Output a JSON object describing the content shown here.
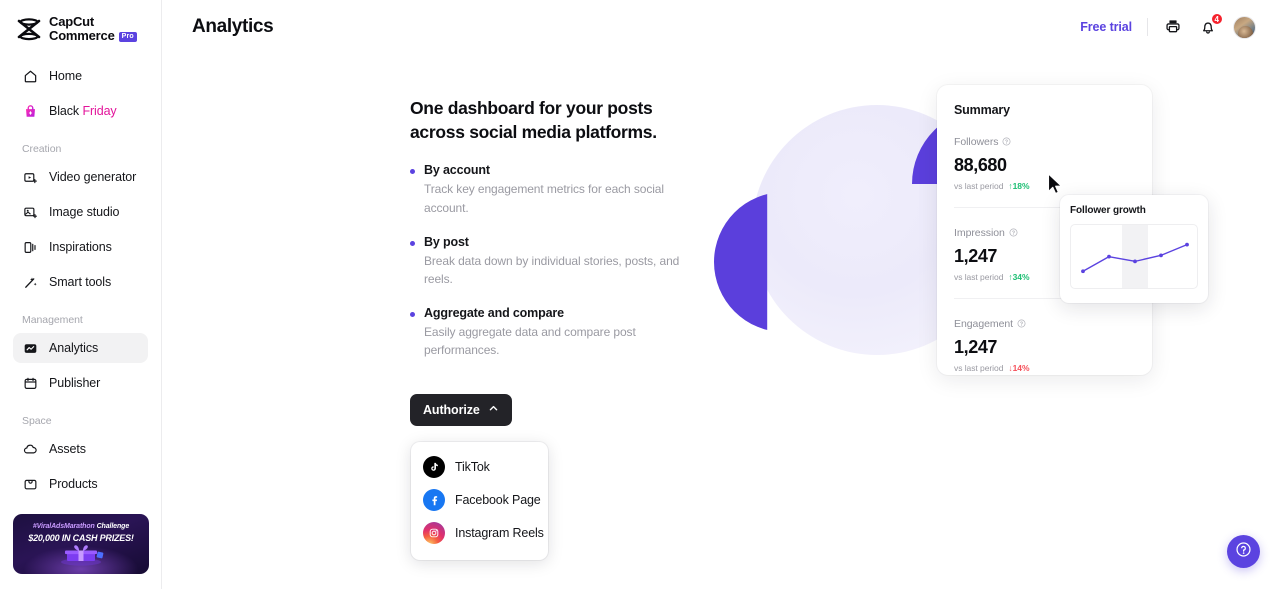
{
  "brand": {
    "line1": "CapCut",
    "line2": "Commerce",
    "badge": "Pro",
    "logo_icon": "capcut-logo-icon"
  },
  "sidebar": {
    "top_items": [
      {
        "label": "Home",
        "icon": "home-icon",
        "active": false
      },
      {
        "label": "Black",
        "label2": "Friday",
        "icon": "bag-icon",
        "active": false
      }
    ],
    "sections": [
      {
        "title": "Creation",
        "items": [
          {
            "label": "Video generator",
            "icon": "video-generator-icon",
            "active": false
          },
          {
            "label": "Image studio",
            "icon": "image-studio-icon",
            "active": false
          },
          {
            "label": "Inspirations",
            "icon": "inspirations-icon",
            "active": false
          },
          {
            "label": "Smart tools",
            "icon": "smart-tools-icon",
            "active": false
          }
        ]
      },
      {
        "title": "Management",
        "items": [
          {
            "label": "Analytics",
            "icon": "analytics-icon",
            "active": true
          },
          {
            "label": "Publisher",
            "icon": "publisher-icon",
            "active": false
          }
        ]
      },
      {
        "title": "Space",
        "items": [
          {
            "label": "Assets",
            "icon": "assets-icon",
            "active": false
          },
          {
            "label": "Products",
            "icon": "products-icon",
            "active": false
          }
        ]
      }
    ],
    "promo": {
      "hashtag": "#ViralAdsMarathon",
      "challenge": " Challenge",
      "prize": "$20,000 IN CASH PRIZES!"
    }
  },
  "header": {
    "title": "Analytics",
    "free_trial": "Free trial",
    "print_icon": "printer-icon",
    "bell_icon": "bell-icon",
    "notification_count": "4",
    "avatar": "user-avatar"
  },
  "hero": {
    "headline": "One dashboard for your posts across social media platforms.",
    "bullets": [
      {
        "title": "By account",
        "desc": "Track key engagement metrics for each social account."
      },
      {
        "title": "By post",
        "desc": "Break data down by individual stories, posts, and reels."
      },
      {
        "title": "Aggregate and compare",
        "desc": "Easily aggregate data and compare post performances."
      }
    ],
    "authorize": {
      "label": "Authorize",
      "chevron_icon": "chevron-up-icon",
      "expanded": true,
      "options": [
        {
          "label": "TikTok",
          "icon": "tiktok-icon"
        },
        {
          "label": "Facebook Page",
          "icon": "facebook-icon"
        },
        {
          "label": "Instagram Reels",
          "icon": "instagram-icon"
        }
      ]
    }
  },
  "summary_card": {
    "title": "Summary",
    "metrics": [
      {
        "label": "Followers",
        "info_icon": "info-icon",
        "value": "88,680",
        "compare_label": "vs last period",
        "delta": "18%",
        "delta_dir": "up",
        "delta_arrow": "↑"
      },
      {
        "label": "Impression",
        "info_icon": "info-icon",
        "value": "1,247",
        "compare_label": "vs last period",
        "delta": "34%",
        "delta_dir": "up",
        "delta_arrow": "↑"
      },
      {
        "label": "Engagement",
        "info_icon": "info-icon",
        "value": "1,247",
        "compare_label": "vs last period",
        "delta": "14%",
        "delta_dir": "down",
        "delta_arrow": "↓"
      }
    ]
  },
  "growth_card": {
    "title": "Follower growth"
  },
  "chart_data": {
    "type": "line",
    "title": "Follower growth",
    "x": [
      1,
      2,
      3,
      4,
      5
    ],
    "values": [
      18,
      52,
      41,
      55,
      80
    ],
    "xlabel": "",
    "ylabel": "",
    "ylim": [
      0,
      100
    ],
    "grid": false,
    "legend": "none",
    "line_color": "#5b43e0",
    "highlight_band": [
      2.5,
      3.5
    ]
  },
  "colors": {
    "accent": "#5b43e0",
    "positive": "#1dbf73",
    "negative": "#f5505a",
    "badge": "#f5222d",
    "dark": "#232328",
    "black_friday": "#e3159b"
  },
  "help_fab": {
    "icon": "question-mark-icon"
  }
}
